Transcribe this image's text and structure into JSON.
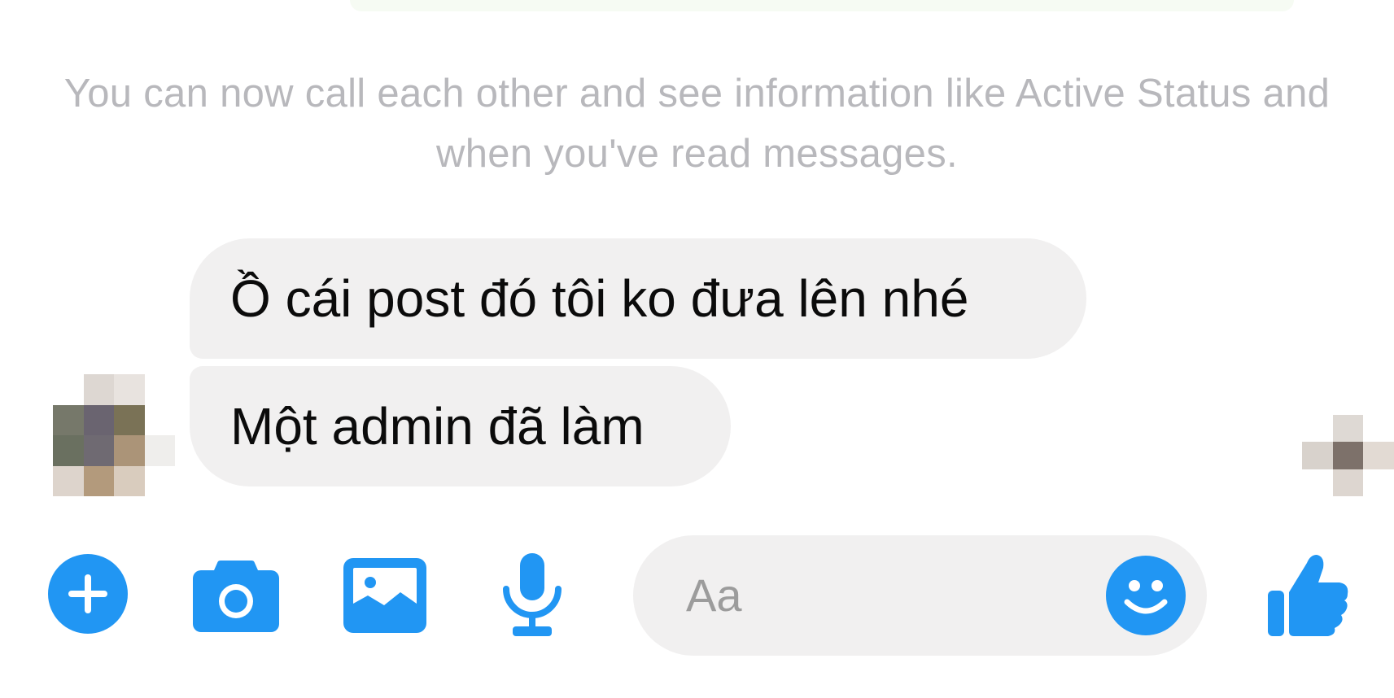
{
  "conversation": {
    "system_notice": "You can now call each other and see information like Active Status and when you've read messages.",
    "messages": [
      {
        "text": "Ồ cái post đó tôi ko đưa lên nhé"
      },
      {
        "text": "Một admin đã làm"
      }
    ]
  },
  "composer": {
    "placeholder": "Aa",
    "icons": {
      "more": "plus-icon",
      "camera": "camera-icon",
      "gallery": "image-icon",
      "voice": "microphone-icon",
      "emoji": "smiley-icon",
      "like": "thumbs-up-icon"
    }
  },
  "theme": {
    "accent": "#2196f3",
    "bubble_bg": "#f1f0f0",
    "notice_text": "#b8b8bc"
  }
}
